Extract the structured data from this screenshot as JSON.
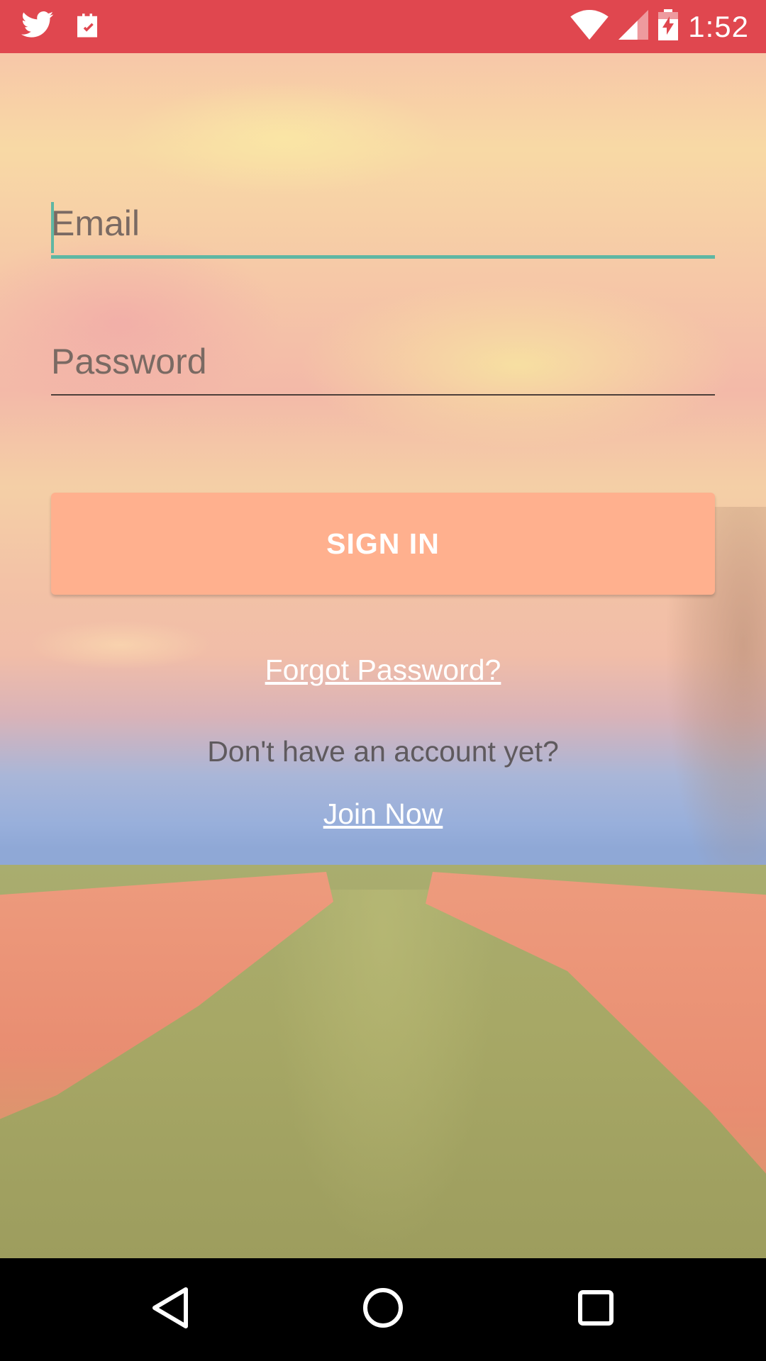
{
  "status_bar": {
    "time": "1:52",
    "left_icons": [
      "twitter-icon",
      "clipboard-check-icon"
    ],
    "right_icons": [
      "wifi-icon",
      "cellular-signal-icon",
      "battery-charging-icon"
    ],
    "background_color": "#e0474f"
  },
  "form": {
    "email": {
      "placeholder": "Email",
      "value": ""
    },
    "password": {
      "placeholder": "Password",
      "value": ""
    },
    "signin_label": "SIGN IN",
    "forgot_label": "Forgot Password?",
    "account_prompt": "Don't have an account yet?",
    "join_label": "Join Now"
  },
  "colors": {
    "accent": "#5fb7a3",
    "button": "#ffb08e"
  },
  "nav_bar": {
    "icons": [
      "back-icon",
      "home-icon",
      "recents-icon"
    ]
  }
}
